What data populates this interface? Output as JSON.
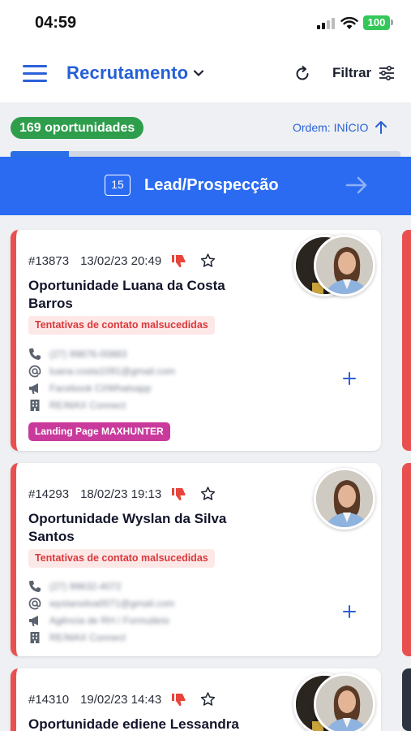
{
  "status": {
    "time": "04:59",
    "battery": "100"
  },
  "header": {
    "title": "Recrutamento",
    "filter_label": "Filtrar"
  },
  "toolbar": {
    "count": "169 oportunidades",
    "order": "Ordem: INÍCIO"
  },
  "pipeline": {
    "progress_fraction": 0.15
  },
  "stage": {
    "count": "15",
    "name": "Lead/Prospecção"
  },
  "cards": [
    {
      "id": "#13873",
      "date": "13/02/23 20:49",
      "title": "Oportunidade Luana da Costa Barros",
      "status_tag": "Tentativas de contato malsucedidas",
      "phone": "(27) 99876-00883",
      "email": "luana.costa1091@gmail.com",
      "channel": "Facebook CI/Whatsapp",
      "company": "RE/MAX Connect",
      "source_tag": "Landing Page MAXHUNTER"
    },
    {
      "id": "#14293",
      "date": "18/02/23 19:13",
      "title": "Oportunidade Wyslan da Silva Santos",
      "status_tag": "Tentativas de contato malsucedidas",
      "phone": "(27) 99632-4072",
      "email": "wyslansilva0071@gmail.com",
      "channel": "Agência de RH / Formulário",
      "company": "RE/MAX Connect"
    },
    {
      "id": "#14310",
      "date": "19/02/23 14:43",
      "title": "Oportunidade ediene Lessandra"
    }
  ],
  "colors": {
    "accent": "#2a6bf2",
    "stage_bar": "#2a6bf2",
    "card_border": "#ea4f4f",
    "count_pill": "#2e9e4c",
    "source_tag": "#c93a9c"
  }
}
